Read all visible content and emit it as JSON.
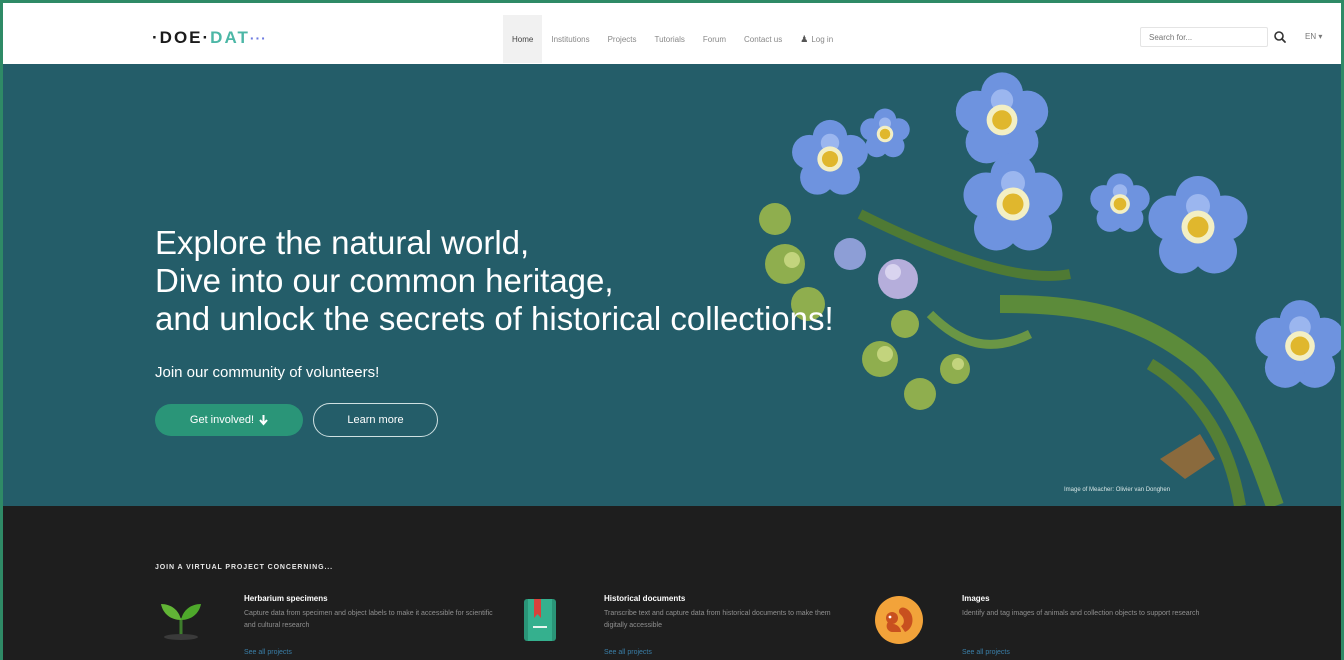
{
  "navbar": {
    "logo": {
      "pre": "·DOE·",
      "highlight": "DAT",
      "trail": "···"
    },
    "links": [
      {
        "label": "Home",
        "active": true
      },
      {
        "label": "Institutions"
      },
      {
        "label": "Projects"
      },
      {
        "label": "Tutorials"
      },
      {
        "label": "Forum"
      },
      {
        "label": "Contact us"
      },
      {
        "label": "Log in"
      }
    ],
    "search_placeholder": "Search for...",
    "language": "EN"
  },
  "hero": {
    "headline_lines": [
      "Explore the natural world,",
      "Dive into our common heritage,",
      "and unlock the secrets of historical collections!"
    ],
    "subheading": "Join our community of volunteers!",
    "primary_button": "Get involved!",
    "secondary_button": "Learn more",
    "image_credit": "Image of Meacher: Olivier van Donghen",
    "background_color": "#245d69"
  },
  "projects": {
    "heading": "JOIN A VIRTUAL PROJECT CONCERNING...",
    "items": [
      {
        "title": "Herbarium specimens",
        "description": "Capture data from specimen and object labels to make it accessible for scientific and cultural research",
        "link": "See all projects",
        "icon": "seedling-icon"
      },
      {
        "title": "Historical documents",
        "description": "Transcribe text and capture data from historical documents to make them digitally accessible",
        "link": "See all projects",
        "icon": "book-icon"
      },
      {
        "title": "Images",
        "description": "Identify and tag images of animals and collection objects to support research",
        "link": "See all projects",
        "icon": "squirrel-icon"
      }
    ]
  },
  "colors": {
    "accent_green": "#2a9578",
    "hero_teal": "#245d69",
    "footer_dark": "#1e1e1e",
    "link_blue": "#3a7fa8"
  }
}
